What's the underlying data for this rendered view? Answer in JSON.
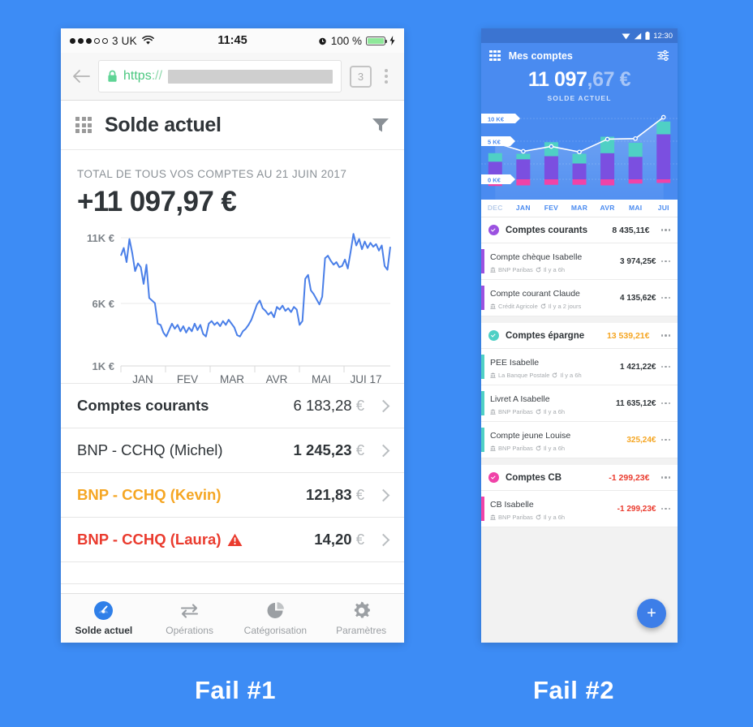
{
  "page": {
    "background_color": "#3d8cf5",
    "caption_1": "Fail #1",
    "caption_2": "Fail #2"
  },
  "phone_ios": {
    "statusbar": {
      "carrier": "3 UK",
      "time": "11:45",
      "battery_label": "100 %",
      "wifi_icon": "wifi-icon",
      "alarm_icon": "alarm-icon",
      "charging_icon": "charging-bolt-icon"
    },
    "browser": {
      "back_icon": "back-arrow-icon",
      "lock_icon": "lock-icon",
      "url_scheme": "https",
      "url_separator": "://",
      "tab_count": "3",
      "menu_icon": "kebab-menu-icon"
    },
    "app_header": {
      "grid_icon": "grid-menu-icon",
      "title": "Solde actuel",
      "filter_icon": "filter-funnel-icon"
    },
    "summary": {
      "label": "TOTAL DE TOUS VOS COMPTES AU 21 JUIN 2017",
      "amount": "+11 097,97 €"
    },
    "chart": {
      "y_labels": [
        "11K €",
        "6K €",
        "1K €"
      ],
      "x_labels": [
        "JAN",
        "FEV",
        "MAR",
        "AVR",
        "MAI",
        "JUI 17"
      ],
      "line_color": "#4a7fe8"
    },
    "accounts": [
      {
        "name": "Comptes courants",
        "amount": "6 183,28",
        "currency": "€",
        "style": "head",
        "warning": false
      },
      {
        "name": "BNP - CCHQ (Michel)",
        "amount": "1 245,23",
        "currency": "€",
        "style": "normal",
        "warning": false
      },
      {
        "name": "BNP - CCHQ (Kevin)",
        "amount": "121,83",
        "currency": "€",
        "style": "orange",
        "warning": false
      },
      {
        "name": "BNP - CCHQ (Laura)",
        "amount": "14,20",
        "currency": "€",
        "style": "red",
        "warning": true
      }
    ],
    "tabs": [
      {
        "label": "Solde actuel",
        "icon": "gauge-icon",
        "active": true
      },
      {
        "label": "Opérations",
        "icon": "transfer-arrows-icon",
        "active": false
      },
      {
        "label": "Catégorisation",
        "icon": "pie-chart-icon",
        "active": false
      },
      {
        "label": "Paramètres",
        "icon": "gear-icon",
        "active": false
      }
    ]
  },
  "phone_android": {
    "statusbar": {
      "time": "12:30",
      "wifi_icon": "wifi-icon",
      "signal_icon": "signal-icon",
      "battery_icon": "battery-icon"
    },
    "header": {
      "grid_icon": "grid-menu-icon",
      "title": "Mes comptes",
      "tune_icon": "tune-sliders-icon",
      "balance_main": "11 097",
      "balance_decimals": ",67 €",
      "subtitle": "SOLDE ACTUEL"
    },
    "chart": {
      "y_labels": [
        "10 K€",
        "5 K€",
        "0 K€"
      ],
      "x_labels": [
        "DEC",
        "JAN",
        "FEV",
        "MAR",
        "AVR",
        "MAI",
        "JUI"
      ],
      "colors": {
        "teal": "#4fd0c5",
        "purple": "#7b4fe0",
        "pink": "#f043a8",
        "line": "#ffffff"
      }
    },
    "groups": [
      {
        "name": "Comptes courants",
        "amount": "8 435,11€",
        "amount_style": "normal",
        "badge_color": "#9b51e0",
        "accent_color": "#9b51e0",
        "accounts": [
          {
            "name": "Compte chèque Isabelle",
            "bank": "BNP Paribas",
            "sync": "Il y a 6h",
            "amount": "3 974,25€",
            "amount_style": "normal"
          },
          {
            "name": "Compte courant Claude",
            "bank": "Crédit Agricole",
            "sync": "Il y a 2 jours",
            "amount": "4 135,62€",
            "amount_style": "normal"
          }
        ]
      },
      {
        "name": "Comptes épargne",
        "amount": "13 539,21€",
        "amount_style": "orange",
        "badge_color": "#4fd0c5",
        "accent_color": "#4fd0c5",
        "accounts": [
          {
            "name": "PEE Isabelle",
            "bank": "La Banque Postale",
            "sync": "Il y a 6h",
            "amount": "1 421,22€",
            "amount_style": "normal"
          },
          {
            "name": "Livret A Isabelle",
            "bank": "BNP Paribas",
            "sync": "Il y a 6h",
            "amount": "11 635,12€",
            "amount_style": "normal"
          },
          {
            "name": "Compte jeune Louise",
            "bank": "BNP Paribas",
            "sync": "Il y a 6h",
            "amount": "325,24€",
            "amount_style": "orange"
          }
        ]
      },
      {
        "name": "Comptes CB",
        "amount": "-1 299,23€",
        "amount_style": "red",
        "badge_color": "#f043a8",
        "accent_color": "#f043a8",
        "accounts": [
          {
            "name": "CB Isabelle",
            "bank": "BNP Paribas",
            "sync": "Il y a 6h",
            "amount": "-1 299,23€",
            "amount_style": "red"
          }
        ]
      }
    ],
    "fab": {
      "icon": "plus-icon",
      "label": "+"
    }
  },
  "chart_data": [
    {
      "type": "line",
      "title": "TOTAL DE TOUS VOS COMPTES AU 21 JUIN 2017",
      "xlabel": "",
      "ylabel": "",
      "ylim": [
        1000,
        11500
      ],
      "ytick_labels": [
        "1K €",
        "6K €",
        "11K €"
      ],
      "ytick_values": [
        1000,
        6000,
        11000
      ],
      "categories": [
        "JAN",
        "FEV",
        "MAR",
        "AVR",
        "MAI",
        "JUI 17"
      ],
      "grid": true,
      "legend": "none",
      "series": [
        {
          "name": "Solde total",
          "values": [
            9600,
            10200,
            9100,
            10900,
            9800,
            8400,
            9000,
            8700,
            7400,
            8900,
            6300,
            6100,
            5900,
            4300,
            4200,
            3600,
            3300,
            3800,
            4300,
            3900,
            4200,
            3700,
            4100,
            3600,
            4000,
            3700,
            4300,
            3800,
            4200,
            3500,
            3300,
            4300,
            4500,
            4200,
            4400,
            4100,
            4500,
            4200,
            4600,
            4300,
            4000,
            3400,
            3300,
            3700,
            3900,
            4200,
            4600,
            5200,
            5800,
            6100,
            5500,
            5300,
            5000,
            5200,
            4800,
            5600,
            5400,
            5700,
            5300,
            5500,
            5200,
            5600,
            5400,
            4200,
            4500,
            7800,
            8100,
            6900,
            6600,
            6200,
            5800,
            6400,
            9400,
            9600,
            9200,
            8900,
            9100,
            8700,
            8800,
            9300,
            8600,
            9900,
            11300,
            10400,
            10900,
            10100,
            10700,
            10200,
            10600,
            10300,
            10500,
            10000,
            10400,
            8800,
            8500,
            10300
          ]
        }
      ]
    },
    {
      "type": "bar",
      "subtype": "stacked-bar-with-line-overlay",
      "title": "Mes comptes",
      "categories": [
        "DEC",
        "JAN",
        "FEV",
        "MAR",
        "AVR",
        "MAI",
        "JUI"
      ],
      "ylim": [
        -1500,
        11000
      ],
      "ytick_labels": [
        "0 K€",
        "5 K€",
        "10 K€"
      ],
      "ytick_values": [
        0,
        5000,
        10000
      ],
      "grid": true,
      "legend": "none",
      "series": [
        {
          "name": "Comptes CB",
          "color": "#f043a8",
          "values": [
            -1100,
            -1000,
            -900,
            -900,
            -1000,
            -700,
            -600
          ]
        },
        {
          "name": "Comptes courants",
          "color": "#7b4fe0",
          "values": [
            2900,
            3300,
            3800,
            2600,
            4300,
            3700,
            7400
          ]
        },
        {
          "name": "Comptes épargne",
          "color": "#4fd0c5",
          "values": [
            1400,
            900,
            2300,
            1600,
            2700,
            2300,
            2100
          ]
        }
      ],
      "overlay_line": {
        "name": "Solde total",
        "color": "#ffffff",
        "values": [
          6000,
          4600,
          5400,
          4500,
          6600,
          6700,
          10200
        ]
      }
    }
  ]
}
